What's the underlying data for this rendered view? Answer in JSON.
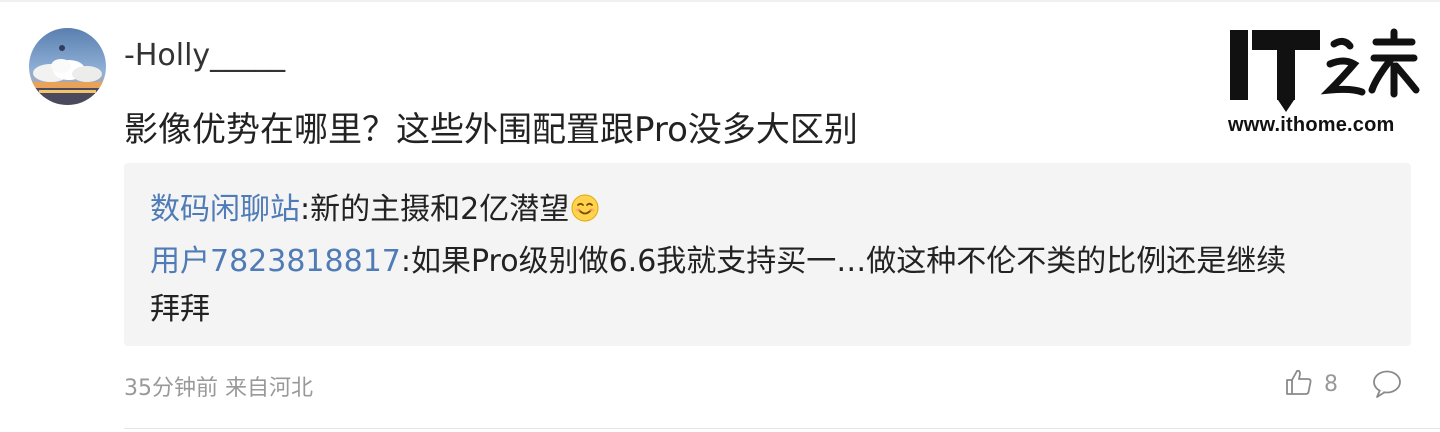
{
  "comment": {
    "username": "-Holly_____",
    "text": "影像优势在哪里？这些外围配置跟Pro没多大区别",
    "replies": [
      {
        "user": "数码闲聊站",
        "separator": ":",
        "text": "新的主摄和2亿潜望",
        "emoji": "smiling-emoji"
      },
      {
        "user": "用户7823818817",
        "separator": ":",
        "text": "如果Pro级别做6.6我就支持买一…做这种不伦不类的比例还是继续",
        "text_cont": "拜拜"
      }
    ],
    "meta": {
      "time_location": "35分钟前 来自河北"
    },
    "actions": {
      "like_count": "8"
    }
  },
  "watermark": {
    "logo_text": "IT之家",
    "url": "www.ithome.com"
  },
  "colors": {
    "reply_user": "#4f7bb6",
    "meta": "#999999",
    "quote_bg": "#f4f4f4",
    "text": "#222222"
  },
  "icons": [
    "avatar",
    "smiling-emoji",
    "thumbs-up-icon",
    "comment-bubble-icon",
    "ithome-logo"
  ]
}
